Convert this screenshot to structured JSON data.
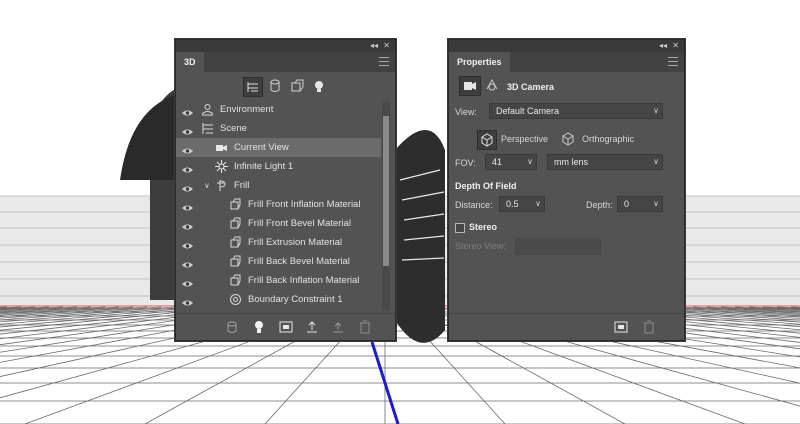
{
  "panel_3d": {
    "tab_label": "3D",
    "collapse_glyph": "◂◂",
    "close_glyph": "✕",
    "filter_icons": [
      "scene-filter-icon",
      "mesh-filter-icon",
      "material-filter-icon",
      "light-filter-icon"
    ],
    "rows": [
      {
        "label": "Environment",
        "icon": "environment-icon",
        "caret": ""
      },
      {
        "label": "Scene",
        "icon": "scene-icon",
        "caret": ""
      },
      {
        "label": "Current View",
        "icon": "camera-icon",
        "caret": ""
      },
      {
        "label": "Infinite Light 1",
        "icon": "light-icon",
        "caret": ""
      },
      {
        "label": "Frill",
        "icon": "mesh-icon",
        "caret": "∨"
      },
      {
        "label": "Frill Front Inflation Material",
        "icon": "material-icon",
        "caret": ""
      },
      {
        "label": "Frill Front Bevel Material",
        "icon": "material-icon",
        "caret": ""
      },
      {
        "label": "Frill Extrusion Material",
        "icon": "material-icon",
        "caret": ""
      },
      {
        "label": "Frill Back Bevel Material",
        "icon": "material-icon",
        "caret": ""
      },
      {
        "label": "Frill Back Inflation Material",
        "icon": "material-icon",
        "caret": ""
      },
      {
        "label": "Boundary Constraint 1",
        "icon": "constraint-icon",
        "caret": ""
      }
    ],
    "selected_row": "Current View",
    "bottom_icons": [
      "mesh-add-icon",
      "light-add-icon",
      "render-icon",
      "ground-icon",
      "export-icon",
      "delete-icon"
    ]
  },
  "panel_properties": {
    "tab_label": "Properties",
    "collapse_glyph": "◂◂",
    "close_glyph": "✕",
    "header_title": "3D Camera",
    "view_label": "View:",
    "view_value": "Default Camera",
    "perspective_label": "Perspective",
    "orthographic_label": "Orthographic",
    "fov_label": "FOV:",
    "fov_value": "41",
    "lens_value": "mm lens",
    "dof_title": "Depth Of Field",
    "distance_label": "Distance:",
    "distance_value": "0.5",
    "depth_label": "Depth:",
    "depth_value": "0",
    "stereo_label": "Stereo",
    "stereo_view_label": "Stereo View:",
    "dropdown_arrow": "∨"
  },
  "colors": {
    "panel_bg": "#535353",
    "header_bg": "#424242",
    "selection": "#6b6b6b",
    "floor_axis": "#1a1ad8",
    "floor_redline": "#e05050"
  }
}
